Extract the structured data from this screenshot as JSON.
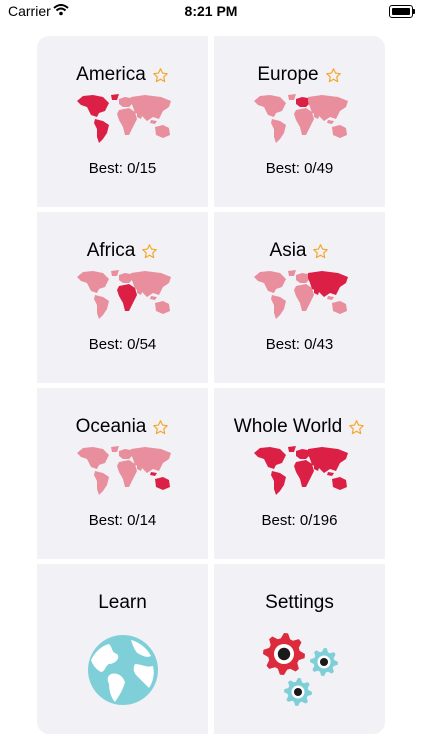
{
  "status_bar": {
    "carrier": "Carrier",
    "time": "8:21 PM"
  },
  "colors": {
    "tile_bg": "#f2f1f6",
    "map_base": "#e88e9d",
    "map_highlight": "#dc1f45",
    "star": "#f5a623",
    "globe": "#7fcfd8",
    "gear_red": "#dc2b3d",
    "gear_teal": "#7fcfd8"
  },
  "tiles": [
    {
      "title": "America",
      "best": "Best: 0/15",
      "highlight": "america"
    },
    {
      "title": "Europe",
      "best": "Best: 0/49",
      "highlight": "europe"
    },
    {
      "title": "Africa",
      "best": "Best: 0/54",
      "highlight": "africa"
    },
    {
      "title": "Asia",
      "best": "Best: 0/43",
      "highlight": "asia"
    },
    {
      "title": "Oceania",
      "best": "Best: 0/14",
      "highlight": "oceania"
    },
    {
      "title": "Whole World",
      "best": "Best: 0/196",
      "highlight": "all"
    }
  ],
  "learn": {
    "title": "Learn",
    "icon": "globe-icon"
  },
  "settings": {
    "title": "Settings",
    "icon": "gears-icon"
  }
}
